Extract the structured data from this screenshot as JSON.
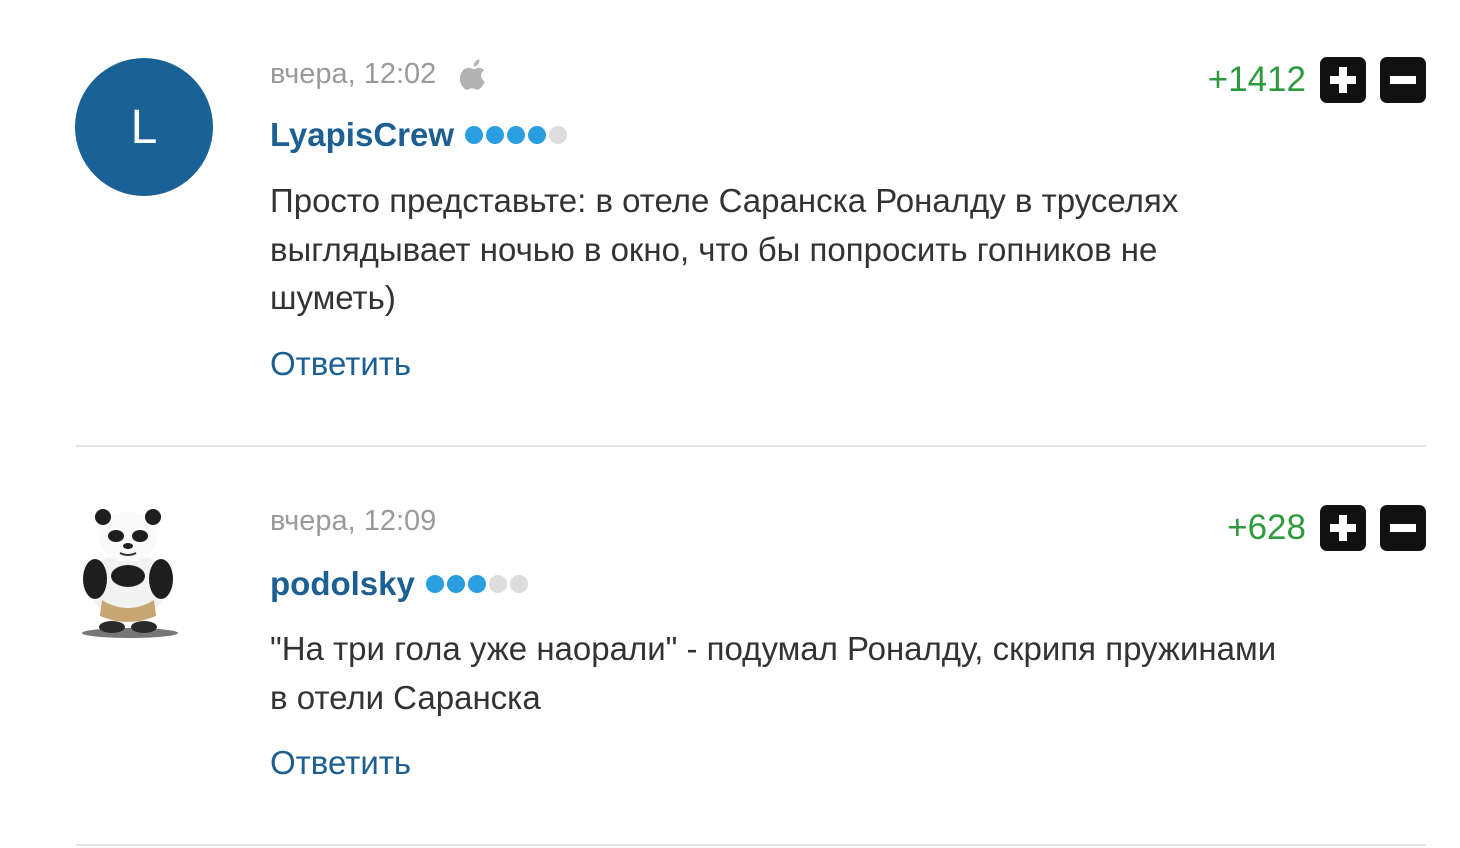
{
  "comments": [
    {
      "avatar_letter": "L",
      "avatar_color": "#1a6296",
      "timestamp": "вчера, 12:02",
      "device_icon": "apple-icon",
      "author": "LyapisCrew",
      "rating": {
        "filled": 4,
        "total": 5
      },
      "text_lines": [
        "Просто представьте: в отеле Саранска Роналду в труселях",
        "выглядывает ночью в окно, что бы попросить гопников не",
        "шуметь)"
      ],
      "reply_label": "Ответить",
      "score": "+1412",
      "upvote_icon": "plus-icon",
      "downvote_icon": "minus-icon"
    },
    {
      "avatar_image": "panda-avatar",
      "timestamp": "вчера, 12:09",
      "author": "podolsky",
      "rating": {
        "filled": 3,
        "total": 5
      },
      "text_lines": [
        "\"На три гола уже наорали\" - подумал Роналду, скрипя пружинами",
        "в отели Саранска"
      ],
      "reply_label": "Ответить",
      "score": "+628",
      "upvote_icon": "plus-icon",
      "downvote_icon": "minus-icon"
    }
  ],
  "colors": {
    "author_link": "#1c5f92",
    "score_positive": "#2e9a3e",
    "rating_on": "#2a9ee0",
    "rating_off": "#dddddd",
    "meta": "#9a9a9a"
  }
}
